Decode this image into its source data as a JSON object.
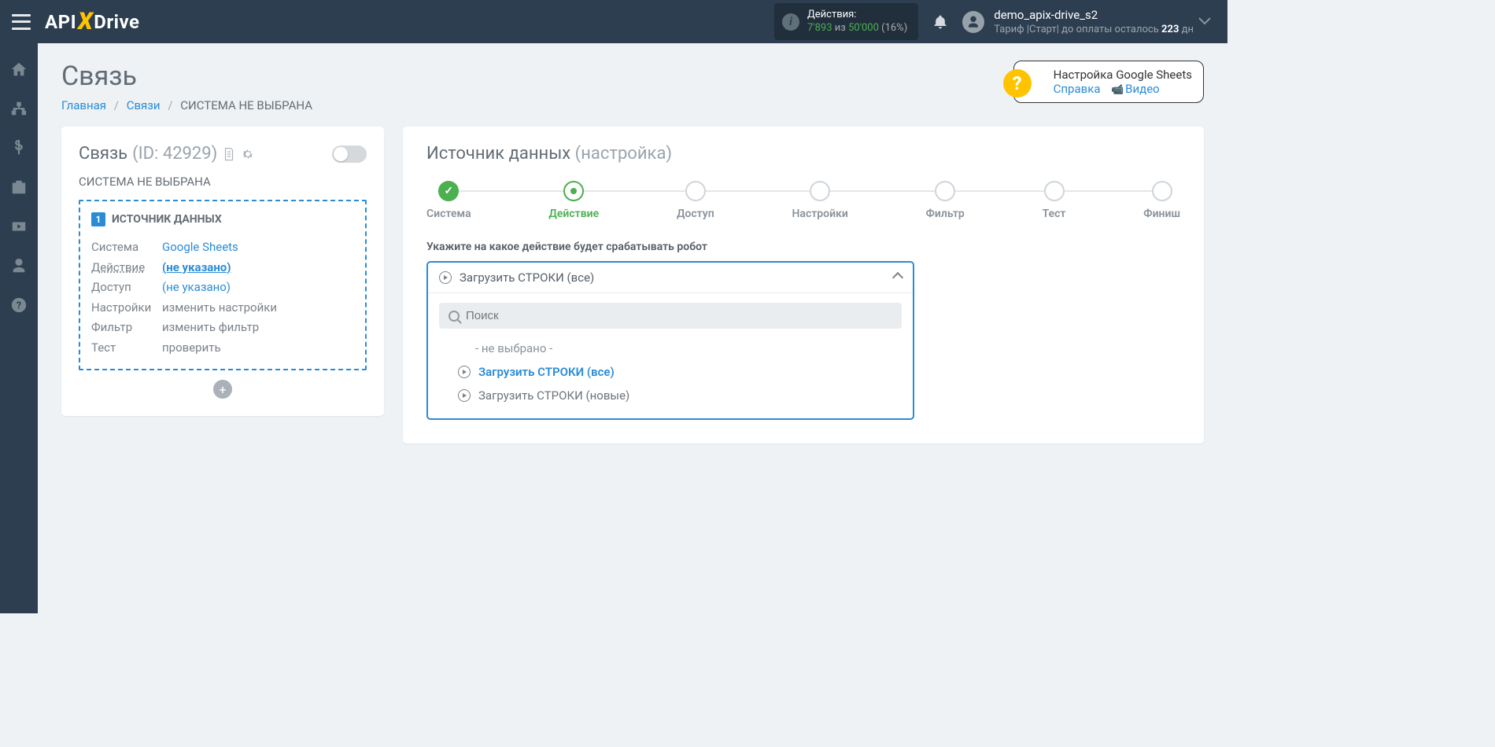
{
  "header": {
    "logo": {
      "api": "API",
      "drive": "Drive"
    },
    "actions": {
      "label": "Действия:",
      "used": "7'893",
      "of_word": "из",
      "limit": "50'000",
      "pct": "(16%)"
    },
    "user": {
      "name": "demo_apix-drive_s2",
      "tariff_prefix": "Тариф |Старт| до оплаты осталось ",
      "days": "223",
      "days_suffix": " дн"
    }
  },
  "page": {
    "title": "Связь",
    "breadcrumbs": {
      "home": "Главная",
      "links": "Связи",
      "current": "СИСТЕМА НЕ ВЫБРАНА"
    }
  },
  "help": {
    "title": "Настройка Google Sheets",
    "help_link": "Справка",
    "video_link": "Видео"
  },
  "conn": {
    "label": "Связь",
    "id_label": "(ID: 42929)",
    "subtitle": "СИСТЕМА НЕ ВЫБРАНА",
    "box_title": "ИСТОЧНИК ДАННЫХ",
    "rows": {
      "system": {
        "label": "Система",
        "value": "Google Sheets"
      },
      "action": {
        "label": "Действие",
        "value": "(не указано)"
      },
      "access": {
        "label": "Доступ",
        "value": "(не указано)"
      },
      "settings": {
        "label": "Настройки",
        "value": "изменить настройки"
      },
      "filter": {
        "label": "Фильтр",
        "value": "изменить фильтр"
      },
      "test": {
        "label": "Тест",
        "value": "проверить"
      }
    }
  },
  "source": {
    "title": "Источник данных",
    "subtitle": "(настройка)",
    "steps": [
      "Система",
      "Действие",
      "Доступ",
      "Настройки",
      "Фильтр",
      "Тест",
      "Финиш"
    ],
    "form_label": "Укажите на какое действие будет срабатывать робот",
    "dropdown": {
      "selected": "Загрузить СТРОКИ (все)",
      "search_placeholder": "Поиск",
      "empty_option": "- не выбрано -",
      "options": [
        "Загрузить СТРОКИ (все)",
        "Загрузить СТРОКИ (новые)"
      ]
    }
  }
}
